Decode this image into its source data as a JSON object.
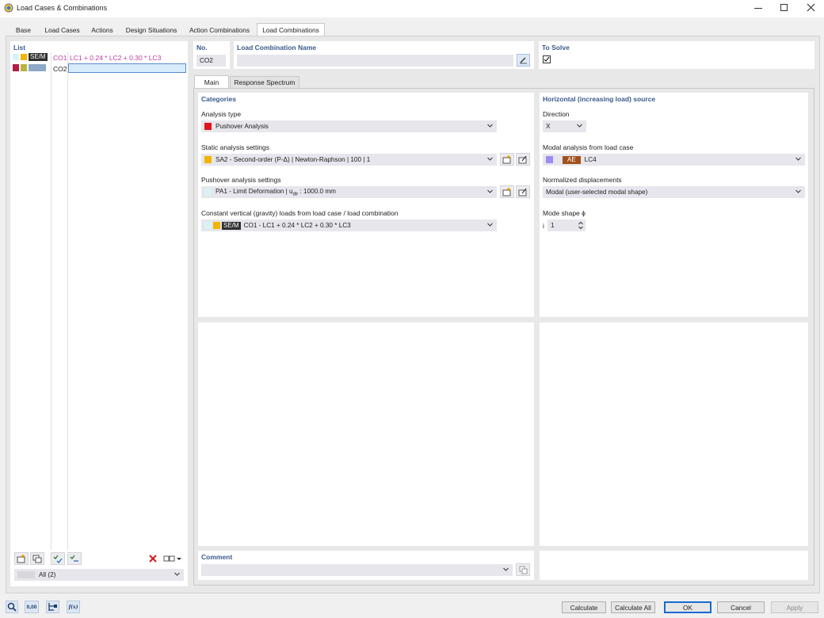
{
  "window": {
    "title": "Load Cases & Combinations"
  },
  "tabs": [
    {
      "label": "Base"
    },
    {
      "label": "Load Cases"
    },
    {
      "label": "Actions"
    },
    {
      "label": "Design Situations"
    },
    {
      "label": "Action Combinations"
    },
    {
      "label": "Load Combinations"
    }
  ],
  "list": {
    "title": "List",
    "items": [
      {
        "badge": "SE/M",
        "id": "CO1",
        "formula": "LC1 + 0.24 * LC2 + 0.30 * LC3"
      },
      {
        "id": "CO2",
        "formula": ""
      }
    ],
    "filter": "All (2)"
  },
  "header": {
    "no_label": "No.",
    "no_value": "CO2",
    "name_label": "Load Combination Name",
    "name_value": "",
    "to_solve_label": "To Solve"
  },
  "subtabs": [
    {
      "label": "Main"
    },
    {
      "label": "Response Spectrum"
    }
  ],
  "categories": {
    "title": "Categories",
    "analysis_type_label": "Analysis type",
    "analysis_type_value": "Pushover Analysis",
    "static_label": "Static analysis settings",
    "static_value": "SA2 - Second-order (P-Δ) | Newton-Raphson | 100 | 1",
    "pushover_label": "Pushover analysis settings",
    "pushover_value": "PA1 - Limit Deformation | u",
    "pushover_sub": "dir",
    "pushover_tail": " : 1000.0 mm",
    "gravity_label": "Constant vertical (gravity) loads from load case / load combination",
    "gravity_badge": "SE/M",
    "gravity_value": "CO1 - LC1 + 0.24 * LC2 + 0.30 * LC3"
  },
  "horizontal": {
    "title": "Horizontal (increasing load) source",
    "direction_label": "Direction",
    "direction_value": "X",
    "modal_label": "Modal analysis from load case",
    "modal_badge": "AE",
    "modal_value": "LC4",
    "normalized_label": "Normalized displacements",
    "normalized_value": "Modal (user-selected modal shape)",
    "mode_shape_label": "Mode shape ϕ",
    "mode_shape_prefix": "i",
    "mode_shape_value": "1"
  },
  "comment": {
    "label": "Comment",
    "value": ""
  },
  "footer": {
    "calculate": "Calculate",
    "calculate_all": "Calculate All",
    "ok": "OK",
    "cancel": "Cancel",
    "apply": "Apply"
  },
  "footer_icons": [
    {
      "icon": "search-icon"
    },
    {
      "icon": "units-icon",
      "text": "0,00"
    },
    {
      "icon": "tree-structure-icon"
    },
    {
      "icon": "function-icon",
      "text": "f(x)"
    }
  ],
  "colors": {
    "accent_blue": "#3a5a8c",
    "pushover_red": "#e2141c",
    "yellow": "#f2b400",
    "cyan": "#d6f4f6",
    "crimson": "#b21e45",
    "olive": "#b6b43e",
    "steel": "#8ea8c8",
    "violet": "#9c8cf0",
    "brown": "#a0521e",
    "dark_badge": "#2e2e2e",
    "magenta_text": "#c0399e"
  }
}
